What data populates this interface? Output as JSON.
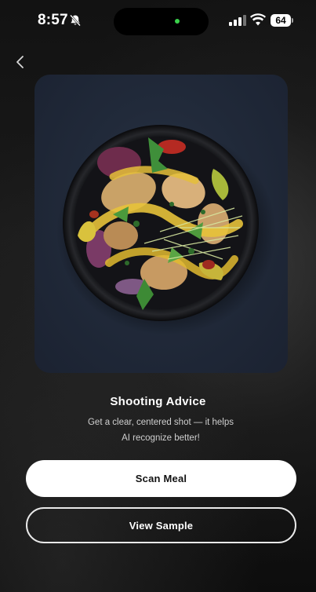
{
  "status_bar": {
    "time": "8:57",
    "battery": "64",
    "icons": [
      "bell-slash-icon",
      "signal-icon",
      "wifi-icon",
      "battery-icon"
    ]
  },
  "navigation": {
    "back_icon": "chevron-left-icon"
  },
  "photo": {
    "subject": "salad bowl photo",
    "background_color": "#212a3a"
  },
  "advice": {
    "title": "Shooting Advice",
    "line1": "Get a clear, centered shot — it helps",
    "line2": "AI recognize better!"
  },
  "actions": {
    "scan_label": "Scan Meal",
    "sample_label": "View Sample"
  },
  "colors": {
    "primary_button_bg": "#ffffff",
    "primary_button_text": "#111111",
    "secondary_border": "#e9e9e9",
    "status_dot": "#3ad14b"
  }
}
